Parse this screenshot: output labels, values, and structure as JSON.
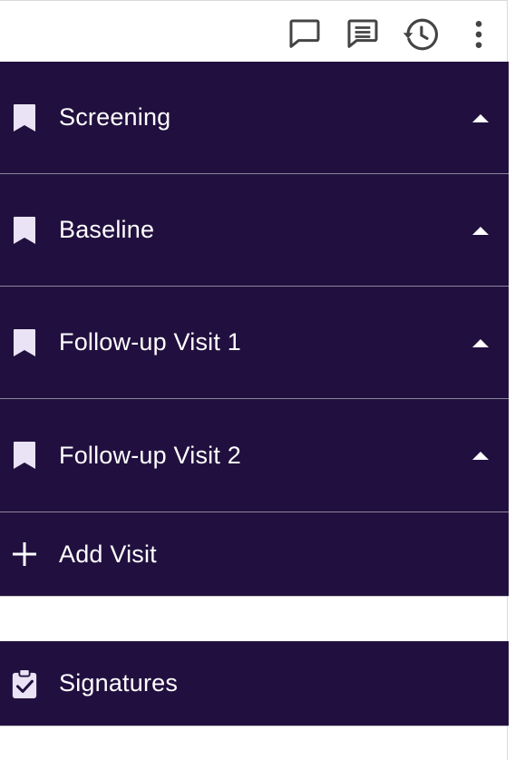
{
  "toolbar": {
    "icons": [
      "comment-icon",
      "notes-icon",
      "history-icon",
      "more-vert-icon"
    ]
  },
  "visits": [
    {
      "label": "Screening",
      "icon": "bookmark-icon",
      "state": "expanded"
    },
    {
      "label": "Baseline",
      "icon": "bookmark-icon",
      "state": "expanded"
    },
    {
      "label": "Follow-up Visit 1",
      "icon": "bookmark-icon",
      "state": "expanded"
    },
    {
      "label": "Follow-up Visit 2",
      "icon": "bookmark-icon",
      "state": "expanded"
    }
  ],
  "add_visit": {
    "label": "Add Visit",
    "icon": "plus-icon"
  },
  "signatures": {
    "label": "Signatures",
    "icon": "clipboard-check-icon"
  },
  "colors": {
    "panel_bg": "#21103f",
    "icon_light": "#e9e3f5",
    "toolbar_icon": "#444444",
    "divider": "#8c8599"
  }
}
